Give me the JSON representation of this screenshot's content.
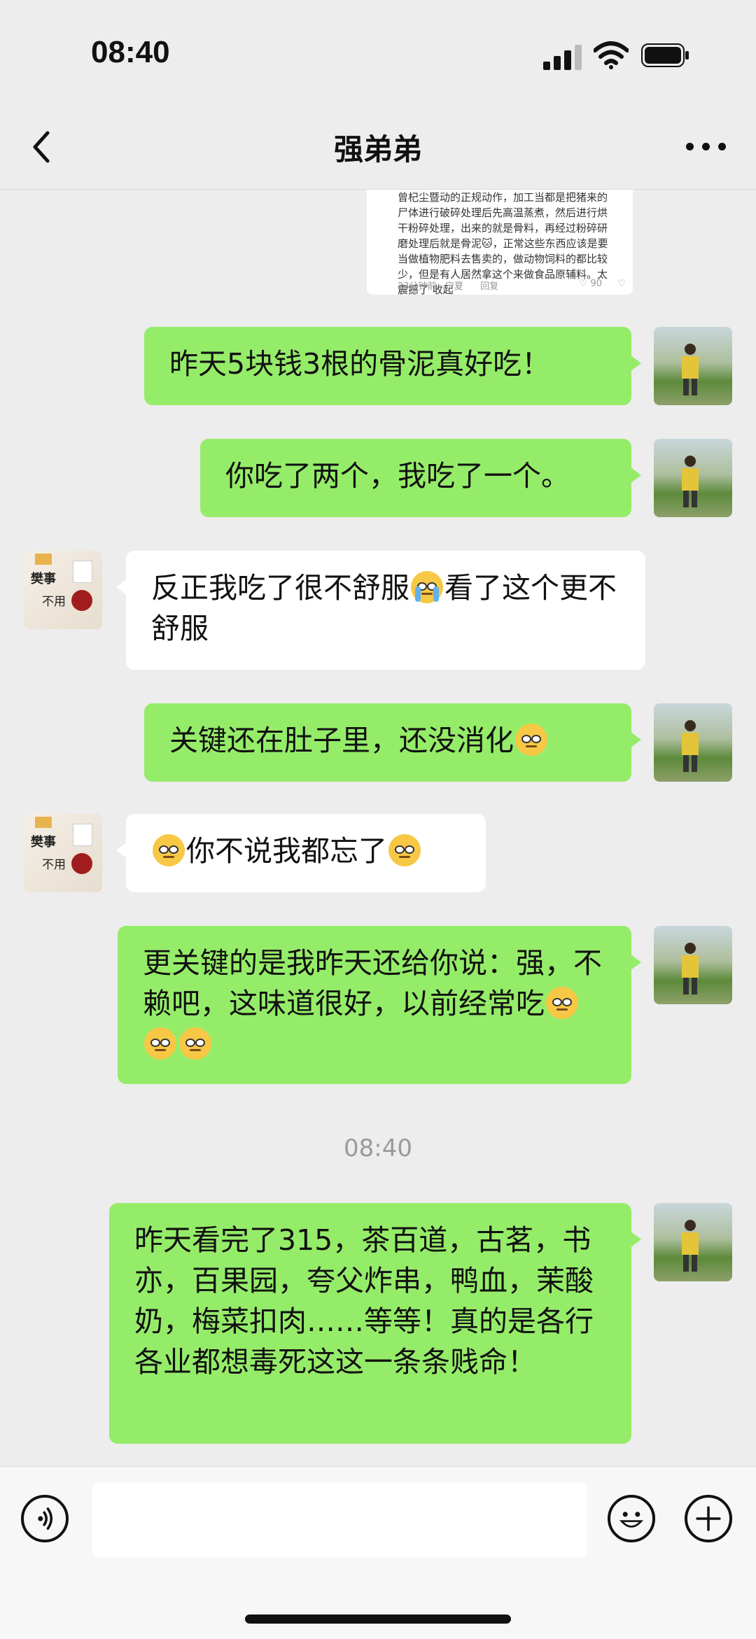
{
  "status_bar": {
    "time": "08:40"
  },
  "header": {
    "title": "强弟弟"
  },
  "quoted_post": {
    "lines": [
      "曾杞尘暨动的正规动作，加工当都是把猪来的",
      "尸体进行破碎处理后先高温蒸煮，然后进行烘",
      "干粉碎处理，出来的就是骨料，再经过粉碎研",
      "磨处理后就是骨泥🐱，正常这些东西应该是要",
      "当做植物肥料去售卖的，做动物饲料的都比较",
      "少，但是有人居然拿这个来做食品原辅料。太",
      "震撼了 收起"
    ],
    "meta": "23分钟前 · 宁夏",
    "reply": "回复",
    "likes": "90"
  },
  "messages": [
    {
      "sender": "me",
      "text": "昨天5块钱3根的骨泥真好吃！"
    },
    {
      "sender": "me",
      "text": "你吃了两个，我吃了一个。"
    },
    {
      "sender": "other",
      "text_before": "反正我吃了很不舒服",
      "text_after": "看了这个更不舒服"
    },
    {
      "sender": "me",
      "text": "关键还在肚子里，还没消化"
    },
    {
      "sender": "other",
      "text_mid": "你不说我都忘了"
    },
    {
      "sender": "me",
      "text": "更关键的是我昨天还给你说：强，不赖吧，这味道很好，以前经常吃"
    },
    {
      "sender": "me",
      "text": "昨天看完了315，茶百道，古茗，书亦，百果园，夸父炸串，鸭血，茉酸奶，梅菜扣肉……等等！真的是各行各业都想毒死这这一条条贱命！"
    }
  ],
  "timestamp": "08:40",
  "avatar_other": {
    "label1": "樊事",
    "label2": "不用"
  },
  "colors": {
    "my_bubble": "#95ec69",
    "other_bubble": "#ffffff",
    "background": "#ededed"
  },
  "icons": [
    "back-icon",
    "more-icon",
    "voice-icon",
    "emoji-icon",
    "plus-icon"
  ]
}
